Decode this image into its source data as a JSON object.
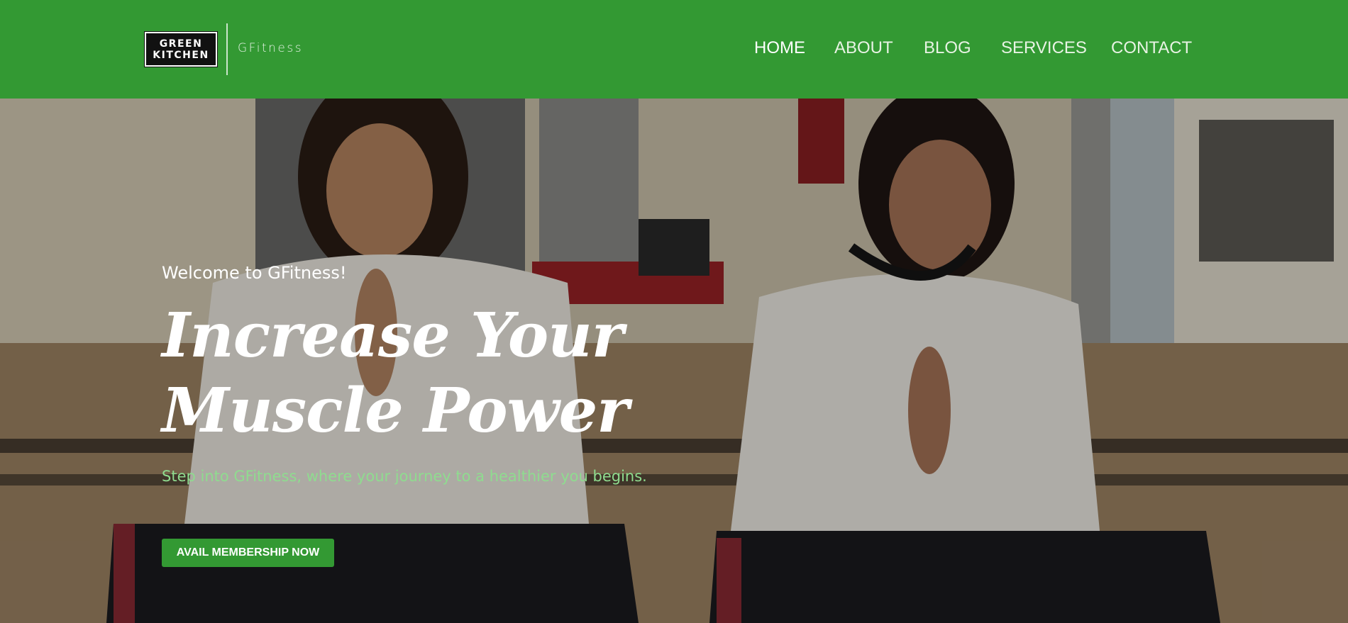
{
  "header": {
    "logo": {
      "line1": "GREEN",
      "line2": "KITCHEN"
    },
    "brand": "GFitness",
    "nav": [
      {
        "label": "HOME",
        "active": true
      },
      {
        "label": "ABOUT",
        "active": false
      },
      {
        "label": "BLOG",
        "active": false
      },
      {
        "label": "SERVICES",
        "active": false
      },
      {
        "label": "CONTACT",
        "active": false
      }
    ]
  },
  "hero": {
    "welcome": "Welcome to GFitness!",
    "headline_line1": "Increase Your",
    "headline_line2": "Muscle Power",
    "tagline": "Step into GFitness, where your journey to a healthier you begins.",
    "cta_label": "AVAIL MEMBERSHIP NOW"
  },
  "colors": {
    "brand_green": "#339933",
    "tagline_green": "#8fdc8f",
    "nav_text": "#e8f3e4"
  }
}
